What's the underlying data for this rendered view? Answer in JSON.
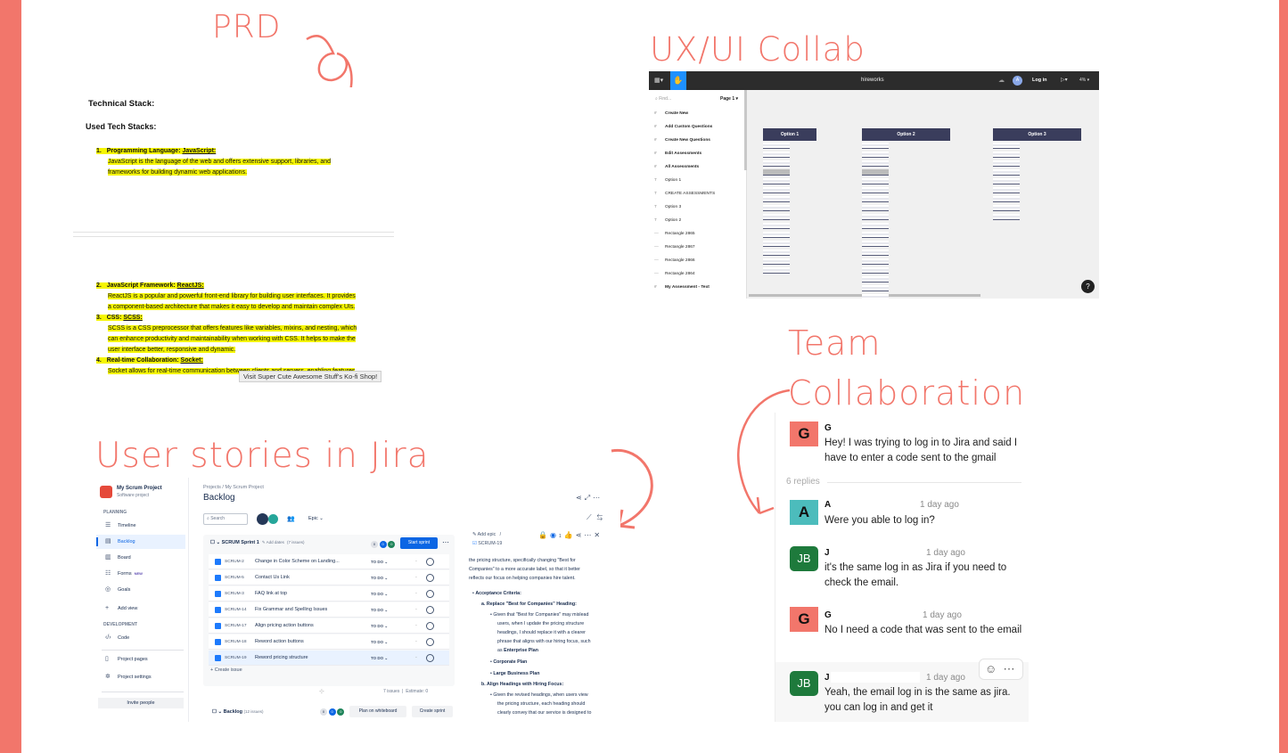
{
  "colors": {
    "accent": "#f2766b",
    "highlight": "#f5f500",
    "jira_blue": "#0c66e4",
    "figma_dark": "#2c2c2c",
    "avatar_g": "#f2766b",
    "avatar_a": "#4cbcbc",
    "avatar_jb": "#1e7a3c"
  },
  "headings": {
    "prd": "PRD",
    "ux": "UX/UI Collab",
    "team_line1": "Team",
    "team_line2": "Collaboration",
    "jira": "User stories in Jira"
  },
  "prd": {
    "h1": "Technical Stack:",
    "h2": "Used Tech Stacks:",
    "item1_num": "1.",
    "item1_label": "Programming Language: ",
    "item1_link": "JavaScript:",
    "item1_text_a": "JavaScript is the language of the web and offers extensive support, libraries, and",
    "item1_text_b": "frameworks for building dynamic web applications.",
    "item2_num": "2.",
    "item2_label": "JavaScript Framework: ",
    "item2_link": "ReactJS:",
    "item2_text_a": "ReactJS is a popular and powerful front-end library for building user interfaces. It provides",
    "item2_text_b": "a component-based architecture that makes it easy to develop and maintain complex UIs.",
    "item3_num": "3.",
    "item3_label": "CSS: ",
    "item3_link": "SCSS:",
    "item3_text_a": "SCSS is a CSS preprocessor that offers features like variables, mixins, and nesting, which",
    "item3_text_b": "can enhance productivity and maintainability when working with CSS. It helps to make the",
    "item3_text_c": "user interface better, responsive and dynamic.",
    "item4_num": "4.",
    "item4_label": "Real-time Collaboration: ",
    "item4_link": "Socket:",
    "item4_text_a": "Socket allows for real-time communication between clients and servers, enabling features",
    "tooltip": "Visit Super Cute Awesome Stuff's Ko-fi Shop!"
  },
  "figma": {
    "file_title": "hireworks",
    "login": "Log in",
    "avatar": "A",
    "zoom": "4%",
    "find": "Find...",
    "page": "Page 1",
    "layers": [
      {
        "icon": "#",
        "label": "Create New",
        "bold": true
      },
      {
        "icon": "#",
        "label": "Add Custom Questions",
        "bold": true
      },
      {
        "icon": "#",
        "label": "Create New Questions",
        "bold": true
      },
      {
        "icon": "#",
        "label": "Edit Assessments",
        "bold": true
      },
      {
        "icon": "#",
        "label": "All Assessments",
        "bold": true
      },
      {
        "icon": "T",
        "label": "Option 1",
        "bold": false
      },
      {
        "icon": "T",
        "label": "CREATE ASSESSMENTS",
        "bold": false
      },
      {
        "icon": "T",
        "label": "Option 3",
        "bold": false
      },
      {
        "icon": "T",
        "label": "Option 2",
        "bold": false
      },
      {
        "icon": "—",
        "label": "Rectangle 2865",
        "bold": false
      },
      {
        "icon": "—",
        "label": "Rectangle 2867",
        "bold": false
      },
      {
        "icon": "—",
        "label": "Rectangle 2866",
        "bold": false
      },
      {
        "icon": "—",
        "label": "Rectangle 2864",
        "bold": false
      },
      {
        "icon": "#",
        "label": "My Assessment - Text",
        "bold": true
      }
    ],
    "frames": [
      "Option 1",
      "Option 2",
      "Option 3"
    ],
    "help": "?"
  },
  "jira": {
    "project_name": "My Scrum Project",
    "project_type": "Software project",
    "section_planning": "PLANNING",
    "section_development": "DEVELOPMENT",
    "nav": {
      "timeline": "Timeline",
      "backlog": "Backlog",
      "board": "Board",
      "forms": "Forms",
      "forms_badge": "NEW",
      "goals": "Goals",
      "add_view": "Add view",
      "code": "Code",
      "project_pages": "Project pages",
      "project_settings": "Project settings",
      "invite": "Invite people"
    },
    "breadcrumb": "Projects  /  My Scrum Project",
    "title": "Backlog",
    "search_placeholder": "Search",
    "epic": "Epic",
    "sprint_name": "SCRUM Sprint 1",
    "add_dates": "Add dates",
    "sprint_count": "(7 issues)",
    "sprint_counts": [
      "0",
      "0",
      "0"
    ],
    "start_sprint": "Start sprint",
    "issues": [
      {
        "key": "SCRUM-2",
        "summary": "Change in Color Scheme on Landing...",
        "status": "TO DO",
        "selected": false
      },
      {
        "key": "SCRUM-5",
        "summary": "Contact Us Link",
        "status": "TO DO",
        "selected": false
      },
      {
        "key": "SCRUM-3",
        "summary": "FAQ link at top",
        "status": "TO DO",
        "selected": false
      },
      {
        "key": "SCRUM-14",
        "summary": "Fix Grammar and Spelling Issues",
        "status": "TO DO",
        "selected": false
      },
      {
        "key": "SCRUM-17",
        "summary": "Align pricing action buttons",
        "status": "TO DO",
        "selected": false
      },
      {
        "key": "SCRUM-18",
        "summary": "Reword action buttons",
        "status": "TO DO",
        "selected": false
      },
      {
        "key": "SCRUM-19",
        "summary": "Reword pricing structure",
        "status": "TO DO",
        "selected": true
      }
    ],
    "create_issue": "Create issue",
    "issues_total": "7 issues",
    "estimate": "Estimate: 0",
    "backlog_label": "Backlog",
    "backlog_count": "(12 issues)",
    "backlog_counts": [
      "0",
      "0",
      "0"
    ],
    "plan_whiteboard": "Plan on whiteboard",
    "create_sprint": "Create sprint",
    "detail": {
      "add_epic": "Add epic",
      "key": "SCRUM-19",
      "watch_count": "1",
      "para_a": "the pricing structure, specifically changing \"Best for",
      "para_b": "Companies\" to a more accurate label, so that it better",
      "para_c": "reflects our focus on helping companies hire talent.",
      "acceptance": "Acceptance Criteria:",
      "a_item": "a. Replace \"Best for Companies\" Heading:",
      "a1": "Given that \"Best for Companies\" may mislead",
      "a2": "users, when I update the pricing structure",
      "a3": "headings, I should replace it with a clearer",
      "a4": "phrase that aligns with our hiring focus, such",
      "a5_pre": "as ",
      "a5_b": "Enterprise Plan",
      "corp": "Corporate Plan",
      "large": "Large Business Plan",
      "b_item": "b. Align Headings with Hiring Focus:",
      "b1": "Given the revised headings, when users view",
      "b2": "the pricing structure, each heading should",
      "b3": "clearly convey that our service is designed to"
    }
  },
  "chat": {
    "messages": [
      {
        "initial": "G",
        "name": "G",
        "time": "",
        "text": "Hey! I was trying to log in to Jira and said I have to enter a code sent to the gmail"
      },
      {
        "initial": "A",
        "name": "A",
        "time": "1 day ago",
        "text": "Were you able to log in?"
      },
      {
        "initial": "JB",
        "name": "J",
        "time": "1 day ago",
        "text": "it's the same log in as Jira if you need to check the email."
      },
      {
        "initial": "G",
        "name": "G",
        "time": "1 day ago",
        "text": "No I need a code that was sent to the email"
      },
      {
        "initial": "JB",
        "name": "J",
        "time": "1 day ago",
        "text": "Yeah, the email log in is the same as jira. you can log in and get it"
      }
    ],
    "replies": "6 replies"
  }
}
